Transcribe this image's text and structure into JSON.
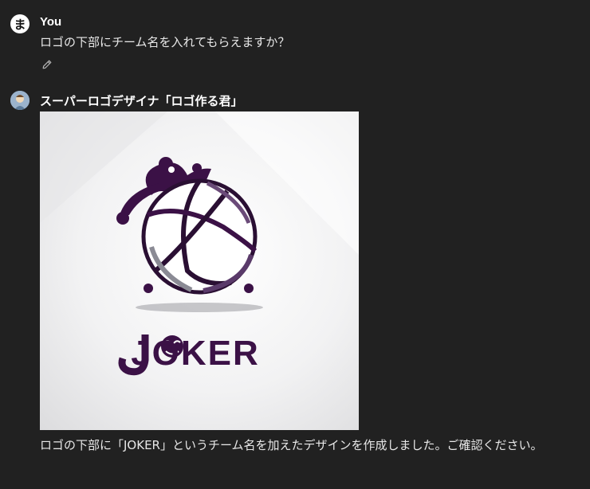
{
  "user_message": {
    "avatar_char": "ま",
    "sender": "You",
    "text": "ロゴの下部にチーム名を入れてもらえますか？",
    "edit_icon": "pencil-icon"
  },
  "assistant_message": {
    "sender": "スーパーロゴデザイナ「ロゴ作る君」",
    "image": {
      "logo_text": "JOKER",
      "description_icon": "volleyball-jester-logo"
    },
    "text": "ロゴの下部に「JOKER」というチーム名を加えたデザインを作成しました。ご確認ください。"
  },
  "colors": {
    "background": "#212121",
    "logo_purple": "#3b1146",
    "text": "#ececec"
  }
}
